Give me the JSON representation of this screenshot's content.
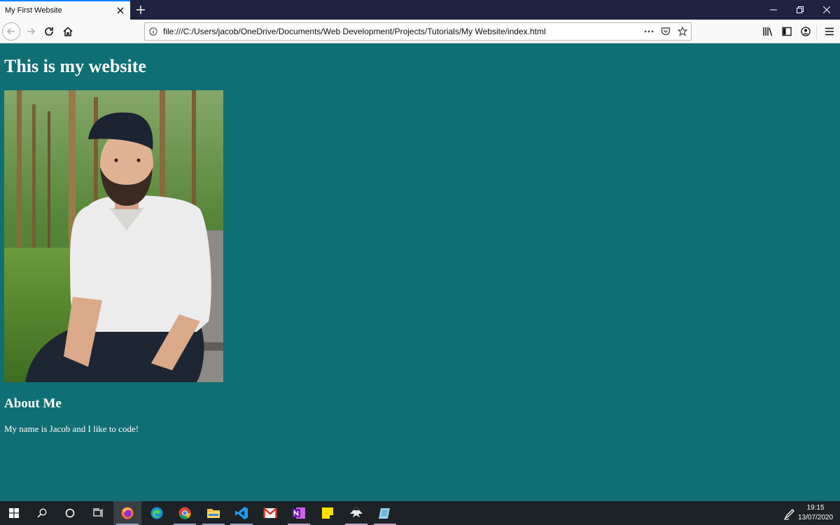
{
  "browser": {
    "tab_title": "My First Website",
    "url": "file:///C:/Users/jacob/OneDrive/Documents/Web Development/Projects/Tutorials/My Website/index.html"
  },
  "page": {
    "heading": "This is my website",
    "about_heading": "About Me",
    "about_text": "My name is Jacob and I like to code!",
    "background_color": "#0f6f74"
  },
  "taskbar": {
    "time": "19:15",
    "date": "13/07/2020",
    "apps": [
      "windows-start",
      "search",
      "cortana",
      "task-view",
      "firefox",
      "edge",
      "chrome",
      "file-explorer",
      "vscode",
      "gmail",
      "onenote",
      "sticky-notes",
      "inkscape",
      "notepad"
    ]
  }
}
